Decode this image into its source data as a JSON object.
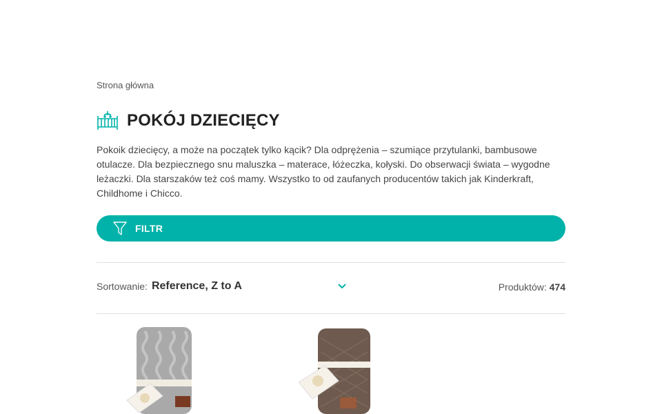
{
  "breadcrumb": {
    "home": "Strona główna"
  },
  "category": {
    "title": "POKÓJ DZIECIĘCY",
    "icon": "crib-icon",
    "description": "Pokoik dziecięcy, a może na początek tylko kącik? Dla odprężenia – szumiące przytulanki, bambusowe otulacze.  Dla bezpiecznego snu maluszka – materace, łóżeczka, kołyski. Do obserwacji świata – wygodne leżaczki. Dla starszaków też coś mamy. Wszystko to od zaufanych producentów takich jak Kinderkraft, Childhome i Chicco."
  },
  "filter": {
    "label": "FILTR",
    "icon": "funnel-icon"
  },
  "sort": {
    "label": "Sortowanie:",
    "value": "Reference, Z to A",
    "icon": "chevron-down-icon"
  },
  "products_count": {
    "label": "Produktów:",
    "value": "474"
  },
  "products": [
    {
      "name": "grey knitted blanket",
      "color": "#a8a8a8"
    },
    {
      "name": "brown knitted blanket",
      "color": "#6e5a4e"
    }
  ],
  "colors": {
    "accent": "#00b2a9"
  }
}
